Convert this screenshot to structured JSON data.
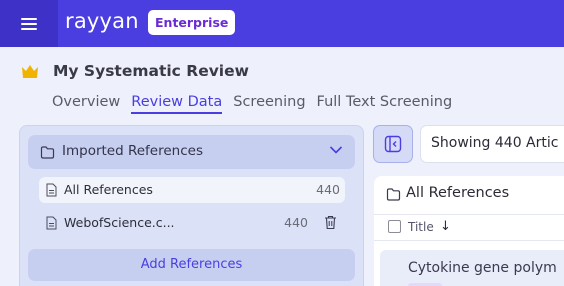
{
  "app": {
    "brand": "rayyan",
    "plan_badge": "Enterprise"
  },
  "review": {
    "title": "My Systematic Review"
  },
  "tabs": [
    {
      "label": "Overview",
      "active": false
    },
    {
      "label": "Review Data",
      "active": true
    },
    {
      "label": "Screening",
      "active": false
    },
    {
      "label": "Full Text Screening",
      "active": false
    }
  ],
  "sidebar": {
    "imported_label": "Imported References",
    "items": [
      {
        "label": "All References",
        "count": "440",
        "selected": true
      },
      {
        "label": "WebofScience.c...",
        "count": "440",
        "selected": false
      }
    ],
    "add_label": "Add References"
  },
  "main": {
    "showing_text": "Showing 440 Artic",
    "section_title": "All References",
    "column_title": "Title",
    "sort_indicator": "↓",
    "first_article_title": "Cytokine gene polym"
  },
  "colors": {
    "topbar": "#4a3ee0",
    "accent": "#4a3ee0",
    "badge_text": "#6a2bd6",
    "review_icon": "#f0b400"
  },
  "icons": {
    "menu": "hamburger-menu-icon",
    "review": "crown-folder-icon",
    "folder": "folder-icon",
    "chevron": "chevron-down-icon",
    "document": "document-icon",
    "trash": "trash-icon",
    "collapse": "collapse-panel-icon"
  }
}
